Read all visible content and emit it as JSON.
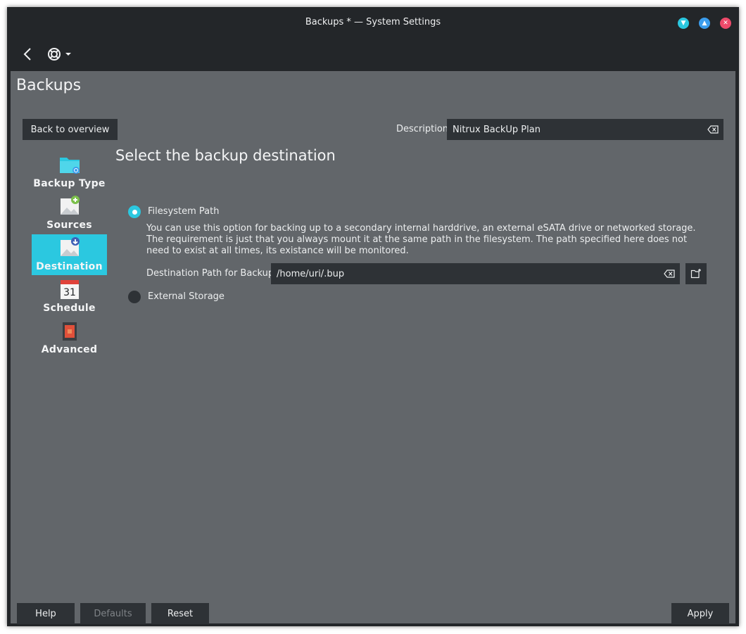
{
  "window": {
    "title": "Backups * — System Settings",
    "buttons": {
      "minimize_icon": "chevron-down-icon",
      "maximize_icon": "chevron-up-icon",
      "close_icon": "close-icon"
    }
  },
  "toolbar": {
    "back_icon": "back-arrow-icon",
    "help_icon": "lifebuoy-icon",
    "menu_icon": "dropdown-arrow-icon"
  },
  "page": {
    "title": "Backups"
  },
  "header": {
    "back_button": "Back to overview",
    "description_label": "Description:",
    "description_value": "Nitrux BackUp Plan"
  },
  "sidebar": {
    "items": [
      {
        "label": "Backup Type",
        "icon": "folder-icon",
        "active": false
      },
      {
        "label": "Sources",
        "icon": "sources-icon",
        "active": false
      },
      {
        "label": "Destination",
        "icon": "destination-icon",
        "active": true
      },
      {
        "label": "Schedule",
        "icon": "calendar-icon",
        "active": false
      },
      {
        "label": "Advanced",
        "icon": "advanced-icon",
        "active": false
      }
    ]
  },
  "main": {
    "section_title": "Select the backup destination",
    "filesystem": {
      "label": "Filesystem Path",
      "selected": true,
      "description": "You can use this option for backing up to a secondary internal harddrive, an external eSATA drive or networked storage. The requirement is just that you always mount it at the same path in the filesystem. The path specified here does not need to exist at all times, its existance will be monitored.",
      "path_label": "Destination Path for Backup:",
      "path_value": "/home/uri/.bup"
    },
    "external": {
      "label": "External Storage",
      "selected": false
    }
  },
  "footer": {
    "help": "Help",
    "defaults": "Defaults",
    "reset": "Reset",
    "apply": "Apply"
  },
  "colors": {
    "accent": "#2bc8e0",
    "window_bg": "#232629",
    "content_bg": "#62666a",
    "field_bg": "#2e3236",
    "close": "#ee4a6a",
    "maximize": "#3b9ded"
  }
}
